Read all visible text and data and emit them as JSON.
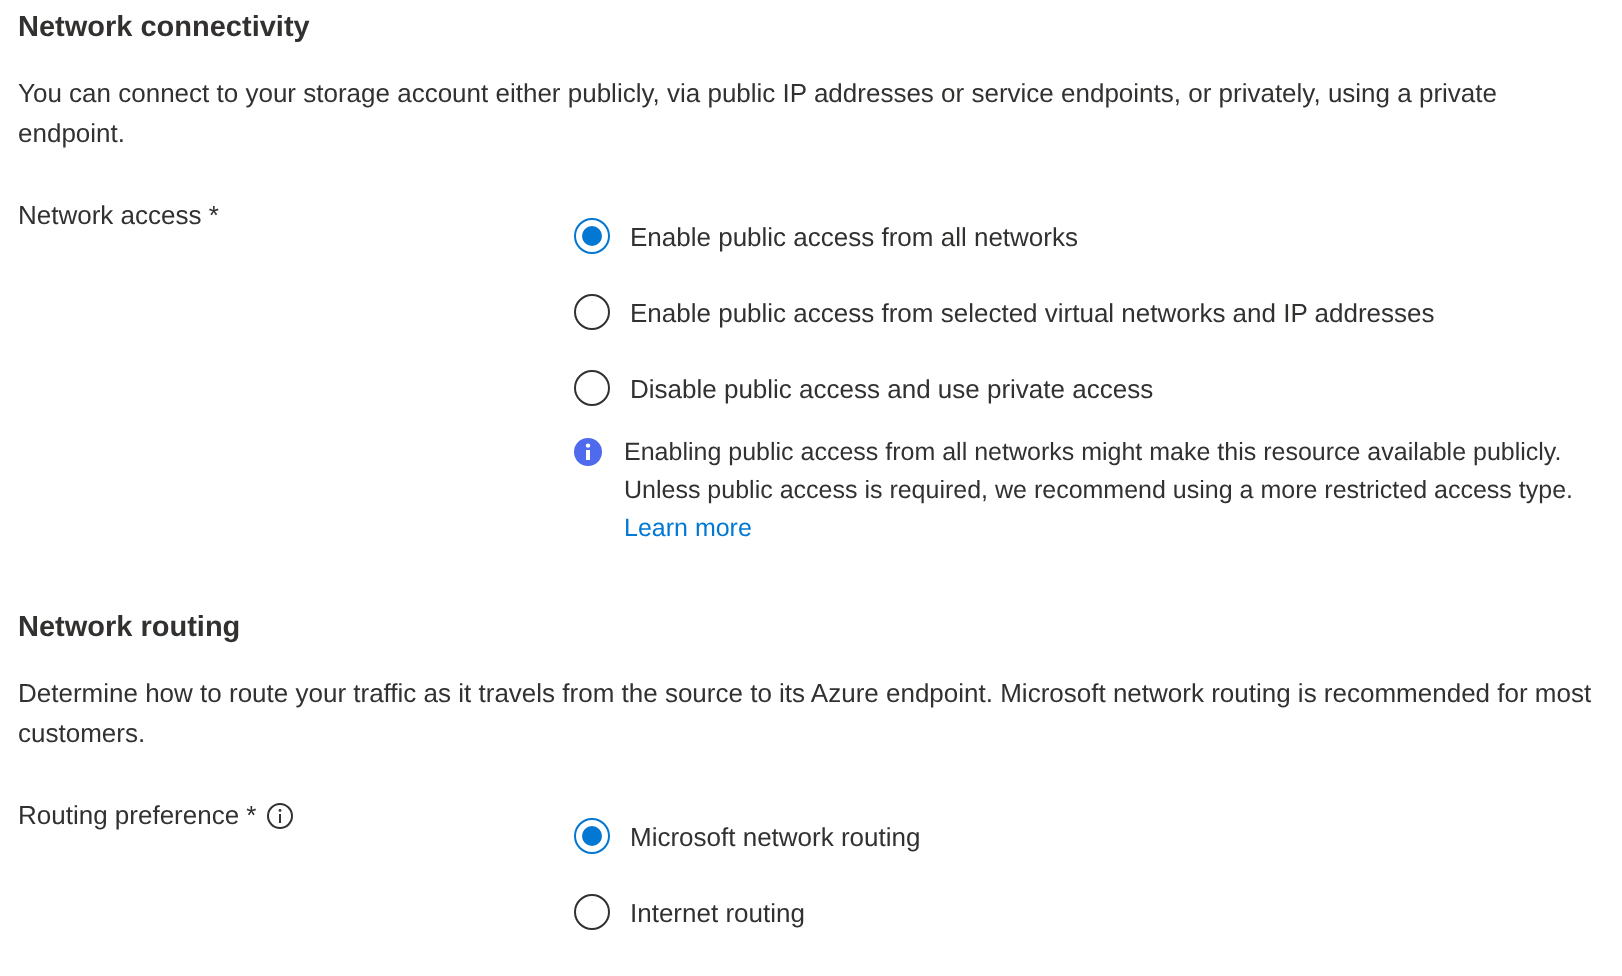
{
  "sections": [
    {
      "title": "Network connectivity",
      "description": "You can connect to your storage account either publicly, via public IP addresses or service endpoints, or privately, using a private endpoint.",
      "field": {
        "label": "Network access *",
        "info_icon": false,
        "options": [
          {
            "label": "Enable public access from all networks",
            "selected": true
          },
          {
            "label": "Enable public access from selected virtual networks and IP addresses",
            "selected": false
          },
          {
            "label": "Disable public access and use private access",
            "selected": false
          }
        ],
        "note": {
          "text": "Enabling public access from all networks might make this resource available publicly. Unless public access is required, we recommend using a more restricted access type.",
          "link": "Learn more"
        }
      }
    },
    {
      "title": "Network routing",
      "description": "Determine how to route your traffic as it travels from the source to its Azure endpoint. Microsoft network routing is recommended for most customers.",
      "field": {
        "label": "Routing preference *",
        "info_icon": true,
        "options": [
          {
            "label": "Microsoft network routing",
            "selected": true
          },
          {
            "label": "Internet routing",
            "selected": false
          }
        ]
      }
    }
  ]
}
